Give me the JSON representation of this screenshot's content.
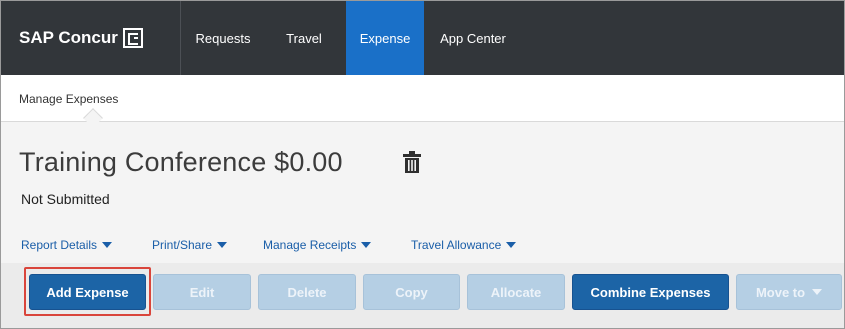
{
  "header": {
    "brand": "SAP Concur",
    "nav": [
      {
        "label": "Requests",
        "active": false
      },
      {
        "label": "Travel",
        "active": false
      },
      {
        "label": "Expense",
        "active": true
      },
      {
        "label": "App Center",
        "active": false
      }
    ]
  },
  "subnav": {
    "item": "Manage Expenses"
  },
  "report": {
    "title": "Training Conference $0.00",
    "status": "Not Submitted"
  },
  "menus": [
    "Report Details",
    "Print/Share",
    "Manage Receipts",
    "Travel Allowance"
  ],
  "toolbar": {
    "add_expense": "Add Expense",
    "edit": "Edit",
    "delete": "Delete",
    "copy": "Copy",
    "allocate": "Allocate",
    "combine_expenses": "Combine Expenses",
    "move_to": "Move to"
  },
  "colors": {
    "nav_background": "#32363a",
    "nav_active": "#1a70c8",
    "primary_button": "#1c64a6",
    "disabled_button": "#b5cfe4",
    "link": "#1a5ea8",
    "highlight_outline": "#d9453b"
  },
  "icons": {
    "brand_mark": "concur-logo-icon",
    "delete_report": "trash-icon",
    "menu_caret": "caret-down-icon"
  }
}
